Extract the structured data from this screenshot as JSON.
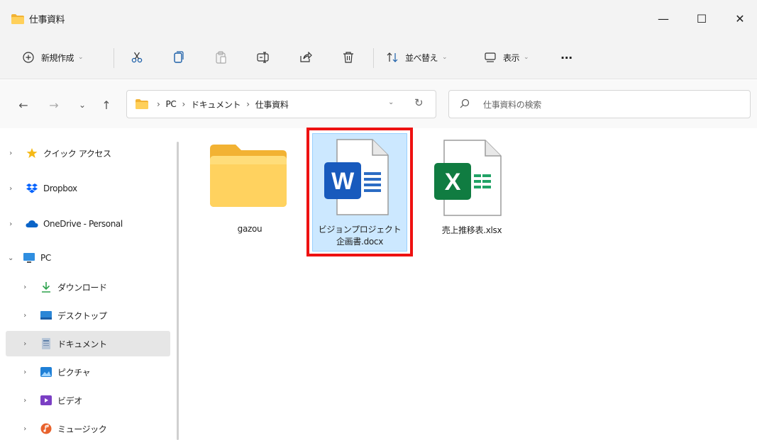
{
  "window": {
    "title": "仕事資料",
    "controls": {
      "minimize": "—",
      "maximize": "☐",
      "close": "✕"
    }
  },
  "commandbar": {
    "new_label": "新規作成",
    "sort_label": "並べ替え",
    "view_label": "表示",
    "more_label": "···",
    "icons": [
      "cut-icon",
      "copy-icon",
      "paste-icon",
      "rename-icon",
      "share-icon",
      "delete-icon"
    ]
  },
  "navigation": {
    "back": "←",
    "forward": "→",
    "recent": "⌄",
    "up": "↑"
  },
  "address": {
    "crumbs": [
      "PC",
      "ドキュメント",
      "仕事資料"
    ],
    "separator": "›"
  },
  "search": {
    "placeholder": "仕事資料の検索"
  },
  "sidebar": {
    "items": [
      {
        "label": "クイック アクセス",
        "icon": "star-icon",
        "expanded": false
      },
      {
        "label": "Dropbox",
        "icon": "dropbox-icon",
        "expanded": false
      },
      {
        "label": "OneDrive - Personal",
        "icon": "cloud-icon",
        "expanded": false
      },
      {
        "label": "PC",
        "icon": "pc-icon",
        "expanded": true
      },
      {
        "label": "ダウンロード",
        "icon": "download-icon",
        "expanded": false
      },
      {
        "label": "デスクトップ",
        "icon": "desktop-icon",
        "expanded": false
      },
      {
        "label": "ドキュメント",
        "icon": "documents-icon",
        "expanded": false,
        "selected": true
      },
      {
        "label": "ピクチャ",
        "icon": "pictures-icon",
        "expanded": false
      },
      {
        "label": "ビデオ",
        "icon": "videos-icon",
        "expanded": false
      },
      {
        "label": "ミュージック",
        "icon": "music-icon",
        "expanded": false
      }
    ]
  },
  "files": [
    {
      "name": "gazou",
      "type": "folder"
    },
    {
      "name_line1": "ビジョンプロジェクト",
      "name_line2": "企画書.docx",
      "type": "word",
      "selected": true
    },
    {
      "name": "売上推移表.xlsx",
      "type": "excel"
    }
  ],
  "colors": {
    "highlight": "#ee1111",
    "selection": "#cce8ff",
    "word": "#185abd",
    "excel": "#107c41",
    "folder": "#f7c548"
  }
}
